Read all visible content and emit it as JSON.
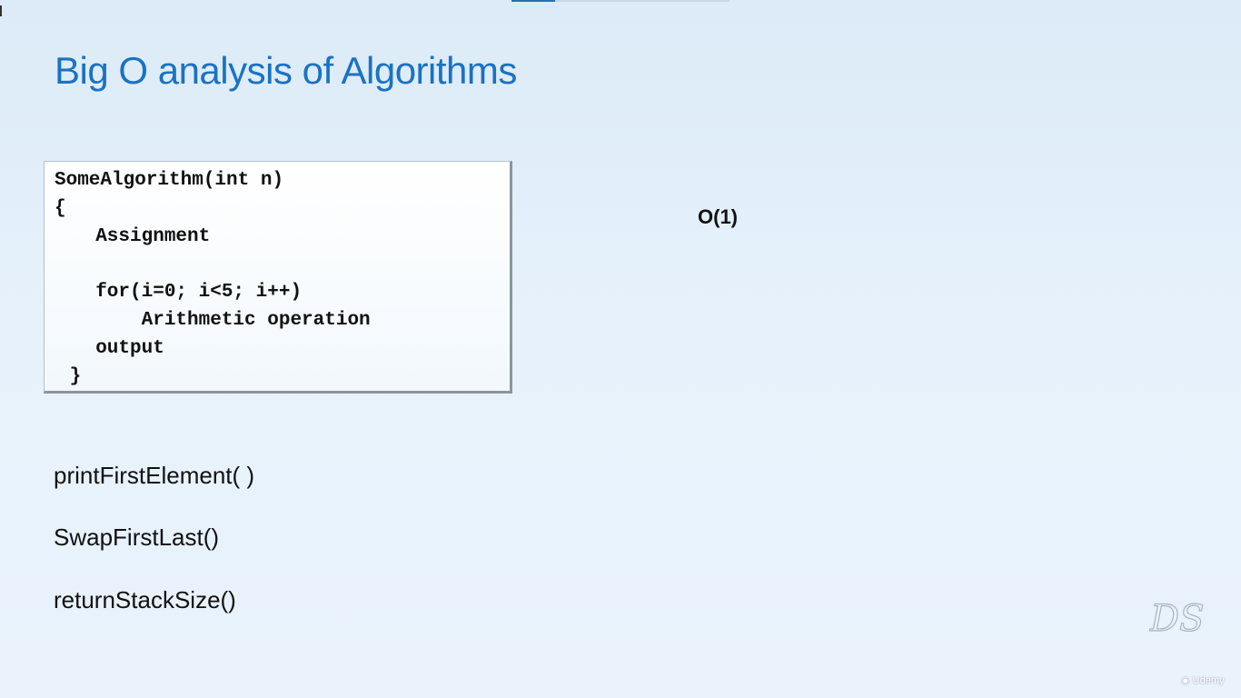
{
  "slide": {
    "title": "Big O analysis of Algorithms"
  },
  "code_block": {
    "lines": [
      "SomeAlgorithm(int n)",
      "{",
      "  Assignment",
      "",
      "  for(i=0; i<5; i++)",
      "      Arithmetic operation",
      "  output",
      " }"
    ]
  },
  "complexity": "O(1)",
  "examples": [
    "printFirstElement( )",
    "SwapFirstLast()",
    "returnStackSize()"
  ],
  "watermark": {
    "text": "DS"
  },
  "logo": {
    "text": "Udemy"
  },
  "video_progress": 0.2,
  "colors": {
    "title": "#1a72c3",
    "background": "#e6f1fb",
    "progress_fill": "#2a6fb5"
  }
}
